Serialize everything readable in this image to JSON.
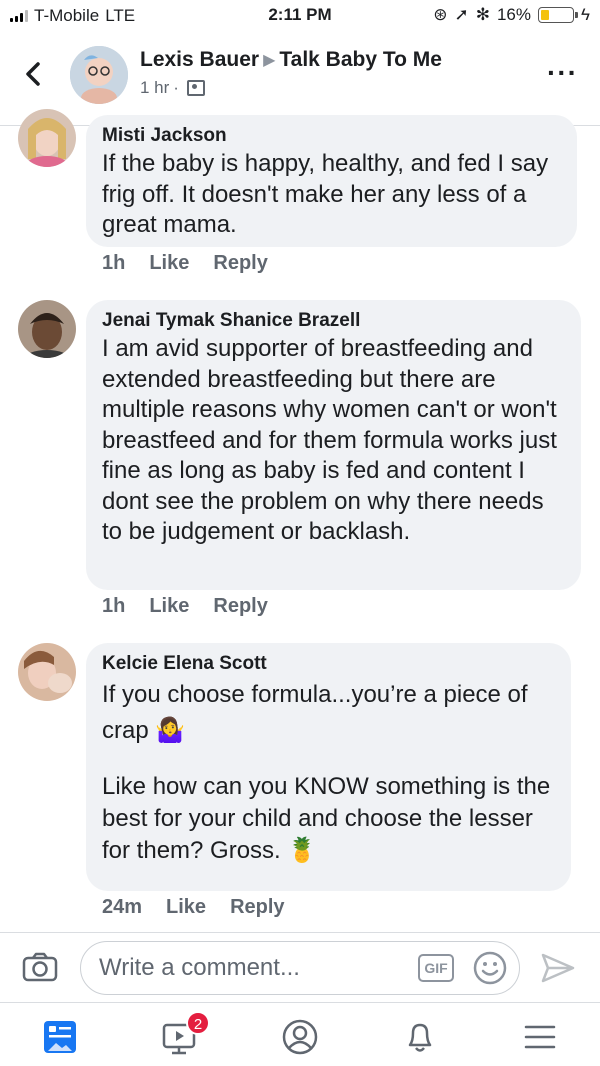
{
  "status_bar": {
    "carrier": "T-Mobile",
    "network": "LTE",
    "time": "2:11 PM",
    "battery_pct": "16%"
  },
  "header": {
    "author": "Lexis Bauer",
    "group": "Talk Baby To Me",
    "time_ago": "1 hr",
    "separator": "·"
  },
  "comments": [
    {
      "name": "Misti Jackson",
      "text": "If the baby is happy, healthy, and fed I say frig off. It doesn't make her any less of a great mama.",
      "time": "1h",
      "like_label": "Like",
      "reply_label": "Reply"
    },
    {
      "name": "Jenai Tymak Shanice Brazell",
      "text": "I am avid supporter of breastfeeding and extended breastfeeding but there are multiple reasons why women can't or won't breastfeed and for them formula works just fine as long as baby is fed and content I dont see the problem on why there needs to be judgement or backlash.",
      "time": "1h",
      "like_label": "Like",
      "reply_label": "Reply"
    },
    {
      "name": "Kelcie Elena Scott",
      "text_1": "If you choose formula...you’re a piece of crap 🤷‍♀️",
      "text_2": "Like how can you KNOW something is the best for your child and choose the lesser for them? Gross. 🍍",
      "time": "24m",
      "like_label": "Like",
      "reply_label": "Reply"
    }
  ],
  "composer": {
    "placeholder": "Write a comment...",
    "gif_label": "GIF"
  },
  "tabbar": {
    "video_badge": "2"
  },
  "colors": {
    "bubble_bg": "#f0f2f5",
    "secondary_text": "#606770",
    "brand_blue": "#1877f2",
    "badge_red": "#e41e3f"
  }
}
